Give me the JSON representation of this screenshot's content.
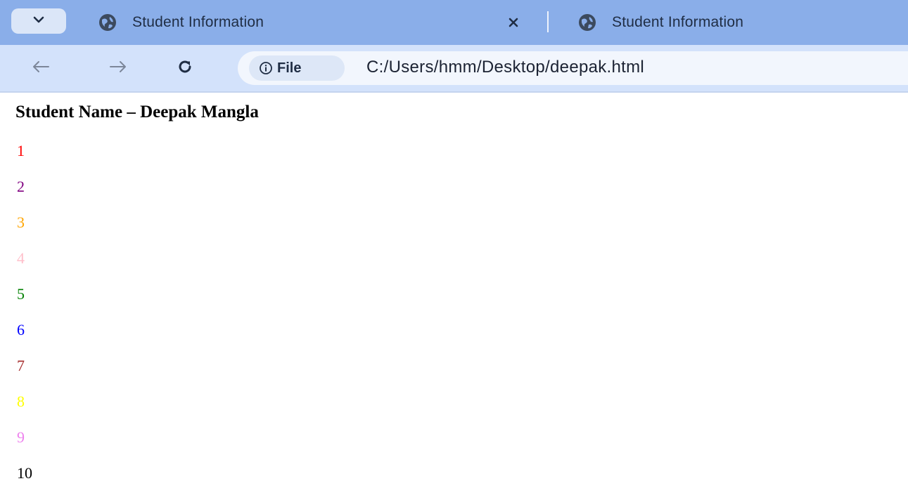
{
  "browser": {
    "tabs": [
      {
        "title": "Student Information",
        "favicon": "globe-icon",
        "active": true
      },
      {
        "title": "Student Information",
        "favicon": "globe-icon",
        "active": false
      }
    ],
    "toolbar": {
      "back_icon": "back-arrow-icon",
      "forward_icon": "forward-arrow-icon",
      "reload_icon": "reload-icon",
      "site_chip_label": "File",
      "site_chip_icon": "info-icon",
      "url": "C:/Users/hmm/Desktop/deepak.html"
    },
    "colors": {
      "tabstrip": "#8aaee9",
      "toolbar": "#d3e2fb"
    }
  },
  "page": {
    "heading": "Student Name – Deepak Mangla",
    "numbers": [
      {
        "text": "1",
        "color": "#ff0000"
      },
      {
        "text": "2",
        "color": "#800080"
      },
      {
        "text": "3",
        "color": "#ffa500"
      },
      {
        "text": "4",
        "color": "#ffc0cb"
      },
      {
        "text": "5",
        "color": "#008000"
      },
      {
        "text": "6",
        "color": "#0000ff"
      },
      {
        "text": "7",
        "color": "#a52a2a"
      },
      {
        "text": "8",
        "color": "#ffff00"
      },
      {
        "text": "9",
        "color": "#ee82ee"
      },
      {
        "text": "10",
        "color": "#000000"
      }
    ]
  }
}
